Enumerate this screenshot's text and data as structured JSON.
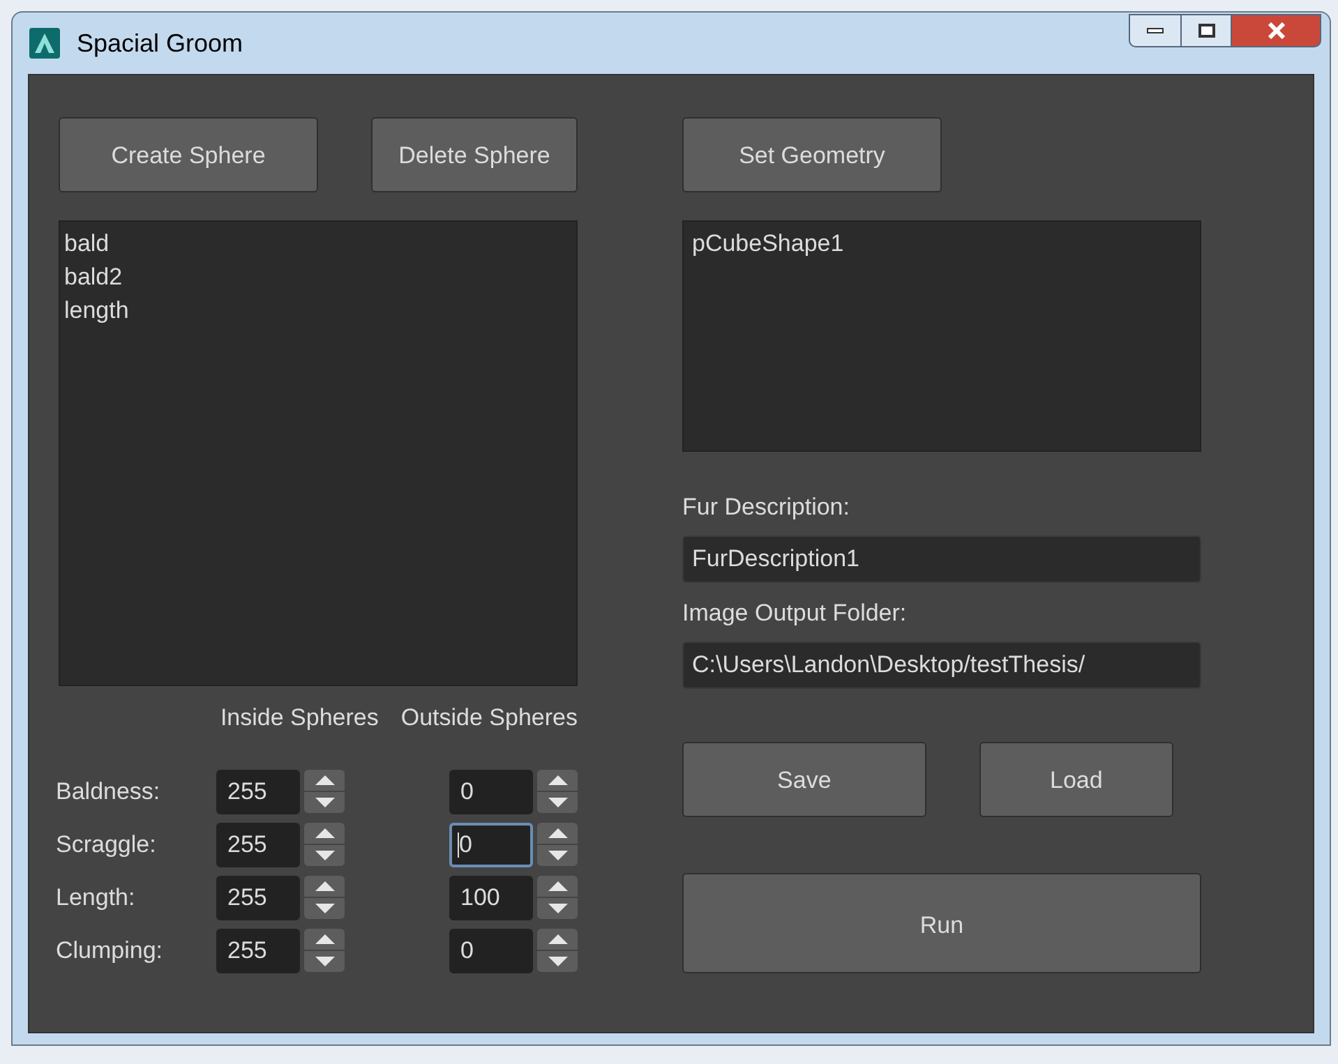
{
  "window": {
    "title": "Spacial Groom"
  },
  "sphere_buttons": [
    "Create Sphere",
    "Delete Sphere"
  ],
  "spheres_list": [
    "bald",
    "bald2",
    "length"
  ],
  "column_headers": [
    "Inside Spheres",
    "Outside Spheres"
  ],
  "parameters": [
    {
      "label": "Baldness:",
      "inside": {
        "value": "255",
        "focused": false
      },
      "outside": {
        "value": "0",
        "focused": false
      }
    },
    {
      "label": "Scraggle:",
      "inside": {
        "value": "255",
        "focused": false
      },
      "outside": {
        "value": "0",
        "focused": true
      }
    },
    {
      "label": "Length:",
      "inside": {
        "value": "255",
        "focused": false
      },
      "outside": {
        "value": "100",
        "focused": false
      }
    },
    {
      "label": "Clumping:",
      "inside": {
        "value": "255",
        "focused": false
      },
      "outside": {
        "value": "0",
        "focused": false
      }
    }
  ],
  "geometry_button": "Set Geometry",
  "geometry_list": [
    "pCubeShape1"
  ],
  "fur_description": {
    "label": "Fur Description:",
    "value": "FurDescription1"
  },
  "image_output_folder": {
    "label": "Image Output Folder:",
    "value": "C:\\Users\\Landon\\Desktop/testThesis/"
  },
  "file_buttons": [
    "Save",
    "Load"
  ],
  "run_button": "Run"
}
